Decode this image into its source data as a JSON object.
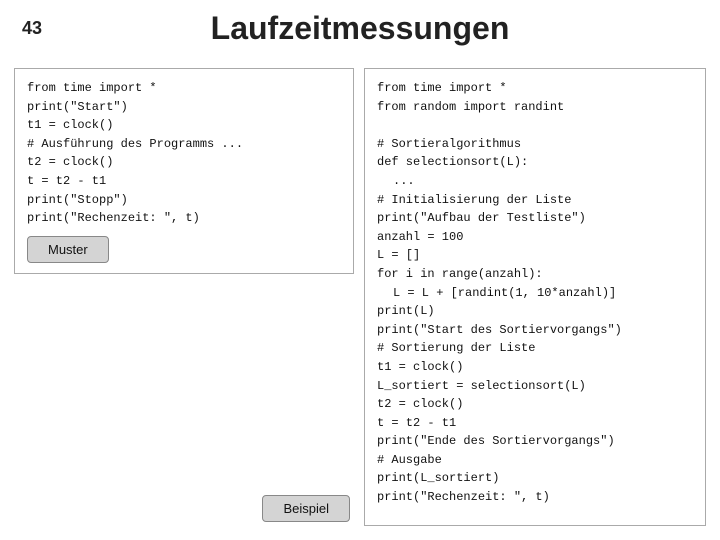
{
  "slide": {
    "number": "43",
    "title": "Laufzeitmessungen"
  },
  "left": {
    "code": "from time import *\nprint(\"Start\")\nt1 = clock()\n# Ausführung des Programms ...\nt2 = clock()\nt = t2 - t1\nprint(\"Stopp\")\nprint(\"Rechenzeit: \", t)",
    "muster_label": "Muster"
  },
  "right": {
    "code_line1": "from time import *",
    "code_line2": "from random import randint",
    "code_line3": "",
    "code_line4": "# Sortieralgorithmus",
    "code_line5": "def selectionsort(L):",
    "code_line6": "    ...",
    "code_line7": "# Initialisierung der Liste",
    "code_line8": "print(\"Aufbau der Testliste\")",
    "code_line9": "anzahl = 100",
    "code_line10": "L = []",
    "code_line11": "for i in range(anzahl):",
    "code_line12": "    L = L + [randint(1, 10*anzahl)]",
    "code_line13": "print(L)",
    "code_line14": "print(\"Start des Sortiervorgangs\")",
    "code_line15": "# Sortierung der Liste",
    "code_line16": "t1 = clock()",
    "code_line17": "L_sortiert = selectionsort(L)",
    "code_line18": "t2 = clock()",
    "code_line19": "t = t2 - t1",
    "code_line20": "print(\"Ende des Sortiervorgangs\")",
    "code_line21": "# Ausgabe",
    "code_line22": "print(L_sortiert)",
    "code_line23": "print(\"Rechenzeit: \", t)"
  },
  "beispiel_label": "Beispiel"
}
